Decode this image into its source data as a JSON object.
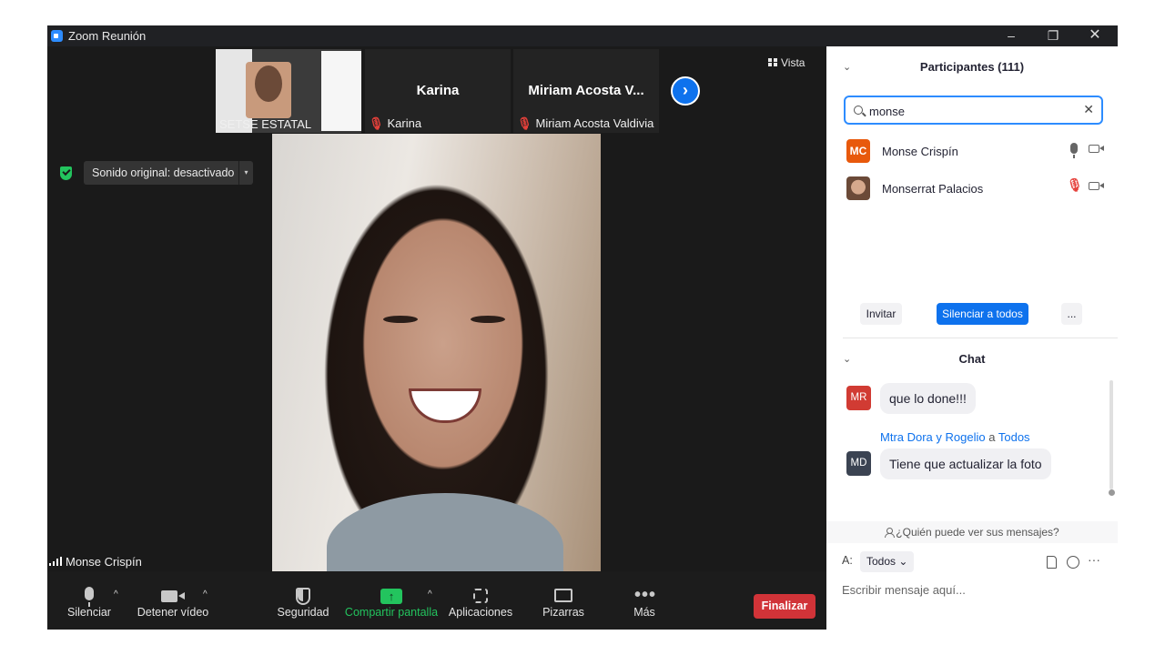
{
  "window": {
    "title": "Zoom Reunión",
    "min_glyph": "–",
    "max_glyph": "❐",
    "close_glyph": "✕"
  },
  "thumbnails": [
    {
      "label": "SETSE ESTATAL",
      "big_name": "",
      "muted": false
    },
    {
      "label": "Karina",
      "big_name": "Karina",
      "muted": true
    },
    {
      "label": "Miriam Acosta Valdivia",
      "big_name": "Miriam Acosta V...",
      "muted": true
    }
  ],
  "next_glyph": "›",
  "view_button": {
    "label": "Vista",
    "icon": "grid-icon"
  },
  "original_sound": {
    "label": "Sonido original: desactivado",
    "caret": "▾"
  },
  "active_speaker": "Monse Crispín",
  "toolbar": {
    "mute": "Silenciar",
    "stop_video": "Detener vídeo",
    "security": "Seguridad",
    "share": "Compartir pantalla",
    "apps": "Aplicaciones",
    "whiteboards": "Pizarras",
    "more": "Más",
    "end": "Finalizar",
    "caret": "^",
    "share_arrow": "↑",
    "more_dots": "•••"
  },
  "participants": {
    "title": "Participantes (111)",
    "chevron": "⌄",
    "search_value": "monse",
    "clear_glyph": "✕",
    "list": [
      {
        "initials": "MC",
        "name": "Monse Crispín",
        "mic": "on",
        "avatar_color": "#e8590c"
      },
      {
        "initials": "",
        "name": "Monserrat Palacios",
        "mic": "off"
      }
    ],
    "mic_off_glyph": "🎙",
    "invite": "Invitar",
    "mute_all": "Silenciar a todos",
    "more": "..."
  },
  "chat": {
    "title": "Chat",
    "chevron": "⌄",
    "messages": [
      {
        "initials": "MR",
        "text": "que lo done!!!",
        "avatar_color": "#d13b33"
      },
      {
        "initials": "MD",
        "sender": "Mtra Dora y Rogelio",
        "connector": "a",
        "recipient": "Todos",
        "text": "Tiene que actualizar la foto",
        "avatar_color": "#3b4352"
      }
    ],
    "privacy": "¿Quién puede ver sus mensajes?",
    "to_label": "A:",
    "to_value": "Todos ⌄",
    "more_dots": "···",
    "placeholder": "Escribir mensaje aquí..."
  },
  "colors": {
    "accent": "#0e72ed",
    "share_green": "#23c45e",
    "end_red": "#d13338",
    "muted_red": "#e5403a"
  }
}
